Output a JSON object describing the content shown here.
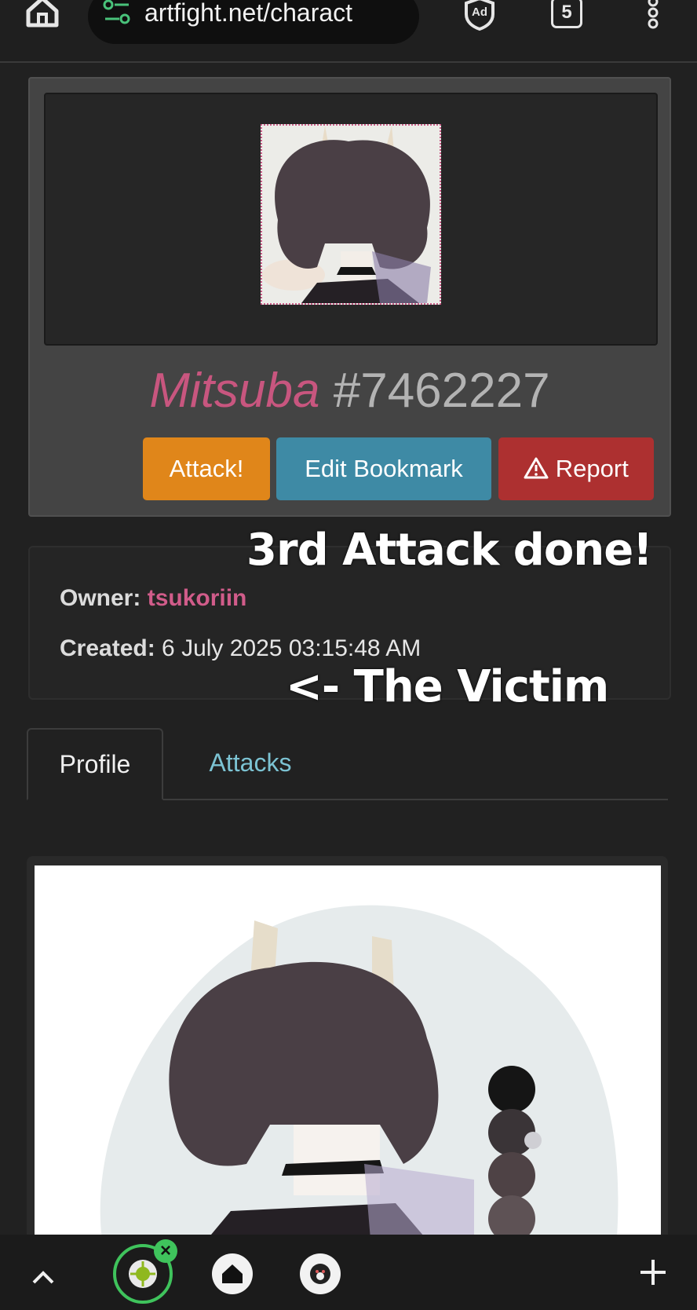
{
  "browser": {
    "url": "artfight.net/charact",
    "tab_count": "5",
    "icons": [
      "home-icon",
      "site-settings-icon",
      "adblock-icon",
      "tabs-icon",
      "overflow-menu-icon"
    ]
  },
  "character": {
    "name": "Mitsuba",
    "id": "#7462227",
    "buttons": {
      "attack": "Attack!",
      "bookmark": "Edit Bookmark",
      "report": "Report"
    }
  },
  "info": {
    "owner_label": "Owner:",
    "owner": "tsukoriin",
    "created_label": "Created:",
    "created": "6 July 2025 03:15:48 AM"
  },
  "overlay": {
    "line1": "3rd Attack done!",
    "line2": "<- The Victim"
  },
  "tabs": [
    "Profile",
    "Attacks"
  ],
  "colors": {
    "accent_pink": "#c8567f",
    "attack_orange": "#e0861a",
    "bookmark_teal": "#3e8aa5",
    "report_red": "#ad3030",
    "link_cyan": "#7cc3d3"
  }
}
